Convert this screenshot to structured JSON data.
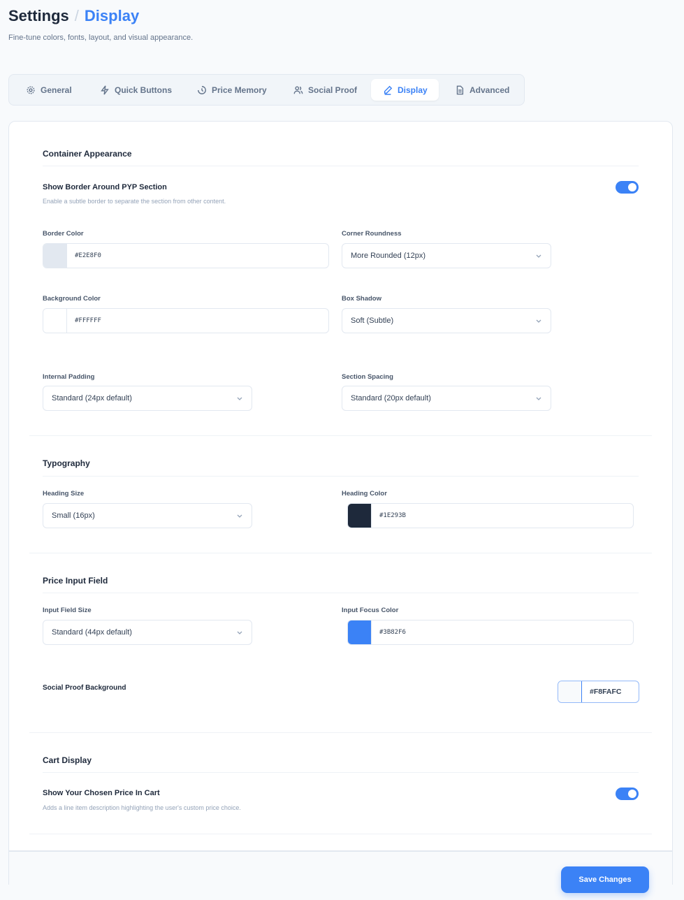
{
  "header": {
    "title": "Settings",
    "separator": "/",
    "current": "Display",
    "subtitle": "Fine-tune colors, fonts, layout, and visual appearance."
  },
  "tabs": [
    {
      "label": "General",
      "icon": "gear-icon"
    },
    {
      "label": "Quick Buttons",
      "icon": "bolt-icon"
    },
    {
      "label": "Price Memory",
      "icon": "history-icon"
    },
    {
      "label": "Social Proof",
      "icon": "users-icon"
    },
    {
      "label": "Display",
      "icon": "pen-icon",
      "active": true
    },
    {
      "label": "Advanced",
      "icon": "document-icon"
    }
  ],
  "container": {
    "heading": "Container Appearance",
    "show_border": {
      "title": "Show Border Around PYP Section",
      "desc": "Enable a subtle border to separate the section from other content.",
      "on": true
    },
    "border_color": {
      "label": "Border Color",
      "value": "#E2E8F0"
    },
    "corner": {
      "label": "Corner Roundness",
      "value": "More Rounded (12px)"
    },
    "bg_color": {
      "label": "Background Color",
      "value": "#FFFFFF"
    },
    "shadow": {
      "label": "Box Shadow",
      "value": "Soft (Subtle)"
    },
    "padding": {
      "label": "Internal Padding",
      "value": "Standard (24px default)"
    },
    "spacing": {
      "label": "Section Spacing",
      "value": "Standard (20px default)"
    }
  },
  "typography": {
    "heading": "Typography",
    "size": {
      "label": "Heading Size",
      "value": "Small (16px)"
    },
    "color": {
      "label": "Heading Color",
      "value": "#1E293B"
    }
  },
  "price_input": {
    "heading": "Price Input Field",
    "size": {
      "label": "Input Field Size",
      "value": "Standard (44px default)"
    },
    "focus": {
      "label": "Input Focus Color",
      "value": "#3B82F6"
    },
    "social_bg": {
      "label": "Social Proof Background",
      "value": "#F8FAFC"
    }
  },
  "cart": {
    "heading": "Cart Display",
    "show_price": {
      "title": "Show Your Chosen Price In Cart",
      "desc": "Adds a line item description highlighting the user's custom price choice.",
      "on": true
    }
  },
  "footer": {
    "save": "Save Changes"
  }
}
